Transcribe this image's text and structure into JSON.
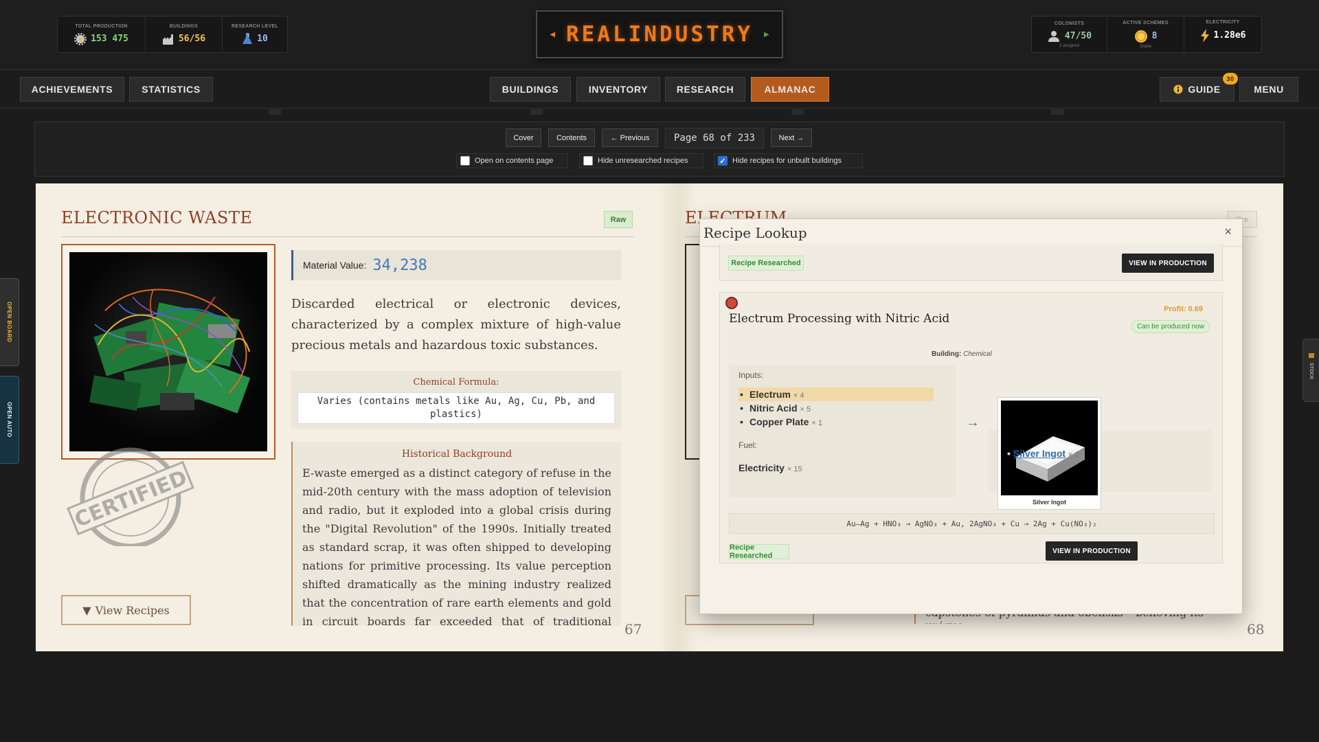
{
  "header": {
    "logo": "REALINDUSTRY",
    "left_stats": [
      {
        "label": "TOTAL PRODUCTION",
        "value": "153 475",
        "icon": "gear-icon",
        "color": "#8fd17a"
      },
      {
        "label": "BUILDINGS",
        "value": "56/56",
        "icon": "factory-icon",
        "color": "#f2c54a"
      },
      {
        "label": "RESEARCH LEVEL",
        "value": "10",
        "icon": "flask-icon",
        "color": "#9fb8ff"
      }
    ],
    "right_stats": [
      {
        "label": "COLONISTS",
        "value": "47/50",
        "sub": "3 assigned",
        "icon": "colonist-icon",
        "color": "#9ec7a0"
      },
      {
        "label": "ACTIVE SCHEMES",
        "value": "8",
        "sub": "Stable",
        "icon": "coin-icon",
        "color": "#9fb8ff"
      },
      {
        "label": "ELECTRICITY",
        "value": "1.28e6",
        "sub": "",
        "icon": "lightning-icon",
        "color": "#ffffff"
      }
    ]
  },
  "nav": {
    "achievements": "ACHIEVEMENTS",
    "statistics": "STATISTICS",
    "buildings": "BUILDINGS",
    "inventory": "INVENTORY",
    "research": "RESEARCH",
    "almanac": "ALMANAC",
    "guide": "GUIDE",
    "guide_badge": "30",
    "menu": "MENU",
    "active_tab": "ALMANAC"
  },
  "almanac_controls": {
    "cover": "Cover",
    "contents": "Contents",
    "previous": "← Previous",
    "next": "Next →",
    "page_indicator": "Page 68 of 233",
    "checkboxes": [
      {
        "label": "Open on contents page",
        "checked": false
      },
      {
        "label": "Hide unresearched recipes",
        "checked": false
      },
      {
        "label": "Hide recipes for unbuilt buildings",
        "checked": true
      }
    ]
  },
  "side_tabs": {
    "board": "OPEN BOARD",
    "auto": "OPEN AUTO",
    "stock": "STOCK"
  },
  "left_page": {
    "title": "ELECTRONIC WASTE",
    "tag": "Raw",
    "stamp": "CERTIFIED",
    "material_value_label": "Material Value:",
    "material_value": "34,238",
    "description": "Discarded electrical or electronic devices, characterized by a complex mixture of high-value precious metals and hazardous toxic substances.",
    "formula_heading": "Chemical Formula:",
    "formula": "Varies (contains metals like Au, Ag, Cu, Pb, and plastics)",
    "history_heading": "Historical Background",
    "history": "E-waste emerged as a distinct category of refuse in the mid-20th century with the mass adoption of television and radio, but it exploded into a global crisis during the \"Digital Revolution\" of the 1990s. Initially treated as standard scrap, it was often shipped to developing nations for primitive processing. Its value perception shifted dramatically as the mining industry realized that the concentration of rare earth elements and gold in circuit boards far exceeded that of traditional geological deposits. This led to the rise of",
    "view_recipes": "View Recipes",
    "page_number": "67"
  },
  "right_page": {
    "title": "ELECTRUM",
    "tag": "Ore",
    "peek_text": "capstones of pyramids and obelisks – believing its unique",
    "page_number": "68"
  },
  "modal": {
    "title": "Recipe Lookup",
    "close": "×",
    "top_card": {
      "status": "Recipe Researched",
      "button": "VIEW IN PRODUCTION"
    },
    "recipe": {
      "name": "Electrum Processing with Nitric Acid",
      "profit": "Profit: 0.69",
      "can_produce": "Can be produced now",
      "building_label": "Building:",
      "building": "Chemical",
      "inputs_label": "Inputs:",
      "inputs": [
        {
          "name": "Electrum",
          "qty": "× 4",
          "highlight": true
        },
        {
          "name": "Nitric Acid",
          "qty": "× 5",
          "highlight": false
        },
        {
          "name": "Copper Plate",
          "qty": "× 1",
          "highlight": false
        }
      ],
      "fuel_label": "Fuel:",
      "fuel": {
        "name": "Electricity",
        "qty": "× 15"
      },
      "output_caption": "Silver Ingot",
      "outputs": [
        {
          "name": "Silver Ingot",
          "qty": "× 2"
        }
      ],
      "equation": "Au–Ag + HNO₃ → AgNO₃ + Au, 2AgNO₃ + Cu → 2Ag + Cu(NO₃)₂",
      "status": "Recipe Researched",
      "button": "VIEW IN PRODUCTION"
    }
  }
}
